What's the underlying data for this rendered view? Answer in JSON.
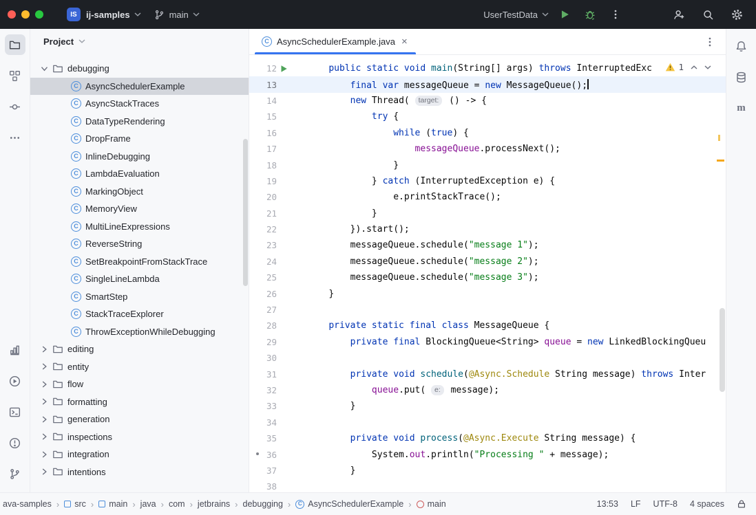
{
  "colors": {
    "accent": "#3574f0",
    "run-green": "#5fad65",
    "warning": "#f5c440",
    "kw": "#0033b3",
    "str": "#067d17",
    "field": "#871094",
    "mth": "#00627a",
    "ann": "#9e880d",
    "caret-row": "#ecf3fd",
    "selection": "#d3d6dc",
    "titlebar": "#1d2025",
    "panel": "#f7f8fa",
    "border": "#ebecf0"
  },
  "titlebar": {
    "project_badge": "IS",
    "project_name": "ij-samples",
    "branch": "main",
    "run_config": "UserTestData"
  },
  "left_strip": {
    "top": [
      "project-folder",
      "structure",
      "commit",
      "more-tools"
    ],
    "bottom": [
      "profiler",
      "services",
      "terminal",
      "problems",
      "version-control"
    ]
  },
  "right_strip": [
    "notifications",
    "database",
    "maven"
  ],
  "project_panel": {
    "title": "Project",
    "tree": [
      {
        "t": "folder",
        "label": "debugging",
        "expanded": true
      },
      {
        "t": "class",
        "label": "AsyncSchedulerExample",
        "selected": true
      },
      {
        "t": "class",
        "label": "AsyncStackTraces"
      },
      {
        "t": "class",
        "label": "DataTypeRendering"
      },
      {
        "t": "class",
        "label": "DropFrame"
      },
      {
        "t": "class",
        "label": "InlineDebugging"
      },
      {
        "t": "class",
        "label": "LambdaEvaluation"
      },
      {
        "t": "class",
        "label": "MarkingObject"
      },
      {
        "t": "class",
        "label": "MemoryView"
      },
      {
        "t": "class",
        "label": "MultiLineExpressions"
      },
      {
        "t": "class",
        "label": "ReverseString"
      },
      {
        "t": "class",
        "label": "SetBreakpointFromStackTrace"
      },
      {
        "t": "class",
        "label": "SingleLineLambda"
      },
      {
        "t": "class",
        "label": "SmartStep"
      },
      {
        "t": "class",
        "label": "StackTraceExplorer"
      },
      {
        "t": "class",
        "label": "ThrowExceptionWhileDebugging"
      },
      {
        "t": "folder",
        "label": "editing"
      },
      {
        "t": "folder",
        "label": "entity"
      },
      {
        "t": "folder",
        "label": "flow"
      },
      {
        "t": "folder",
        "label": "formatting"
      },
      {
        "t": "folder",
        "label": "generation"
      },
      {
        "t": "folder",
        "label": "inspections"
      },
      {
        "t": "folder",
        "label": "integration"
      },
      {
        "t": "folder",
        "label": "intentions"
      }
    ]
  },
  "editor": {
    "tab_label": "AsyncSchedulerExample.java",
    "inspection": {
      "warning_count": "1"
    },
    "lines": [
      {
        "n": "12",
        "run": true,
        "ind": 4,
        "segs": [
          [
            "kw",
            "public static void "
          ],
          [
            "mth",
            "main"
          ],
          [
            "pln",
            "(String[] args) "
          ],
          [
            "kw",
            "throws"
          ],
          [
            "pln",
            " InterruptedExc"
          ]
        ]
      },
      {
        "n": "13",
        "cur": true,
        "caret": true,
        "ind": 8,
        "segs": [
          [
            "kw",
            "final var "
          ],
          [
            "pln",
            "messageQueue = "
          ],
          [
            "kw",
            "new"
          ],
          [
            "pln",
            " MessageQueue();"
          ]
        ]
      },
      {
        "n": "14",
        "ind": 8,
        "segs": [
          [
            "kw",
            "new"
          ],
          [
            "pln",
            " Thread( "
          ],
          [
            "hint",
            "target:"
          ],
          [
            "pln",
            " () -> {"
          ]
        ]
      },
      {
        "n": "15",
        "ind": 12,
        "segs": [
          [
            "kw",
            "try"
          ],
          [
            "pln",
            " {"
          ]
        ]
      },
      {
        "n": "16",
        "ind": 16,
        "segs": [
          [
            "kw",
            "while"
          ],
          [
            "pln",
            " ("
          ],
          [
            "kw",
            "true"
          ],
          [
            "pln",
            ") {"
          ]
        ]
      },
      {
        "n": "17",
        "ind": 20,
        "segs": [
          [
            "field",
            "messageQueue"
          ],
          [
            "pln",
            ".processNext();"
          ]
        ]
      },
      {
        "n": "18",
        "ind": 16,
        "segs": [
          [
            "pln",
            "}"
          ]
        ]
      },
      {
        "n": "19",
        "ind": 12,
        "segs": [
          [
            "pln",
            "} "
          ],
          [
            "kw",
            "catch"
          ],
          [
            "pln",
            " (InterruptedException e) {"
          ]
        ]
      },
      {
        "n": "20",
        "ind": 16,
        "segs": [
          [
            "pln",
            "e.printStackTrace();"
          ]
        ]
      },
      {
        "n": "21",
        "ind": 12,
        "segs": [
          [
            "pln",
            "}"
          ]
        ]
      },
      {
        "n": "22",
        "ind": 8,
        "segs": [
          [
            "pln",
            "}).start();"
          ]
        ]
      },
      {
        "n": "23",
        "ind": 8,
        "segs": [
          [
            "pln",
            "messageQueue.schedule("
          ],
          [
            "str",
            "\"message 1\""
          ],
          [
            "pln",
            ");"
          ]
        ]
      },
      {
        "n": "24",
        "ind": 8,
        "segs": [
          [
            "pln",
            "messageQueue.schedule("
          ],
          [
            "str",
            "\"message 2\""
          ],
          [
            "pln",
            ");"
          ]
        ]
      },
      {
        "n": "25",
        "ind": 8,
        "segs": [
          [
            "pln",
            "messageQueue.schedule("
          ],
          [
            "str",
            "\"message 3\""
          ],
          [
            "pln",
            ");"
          ]
        ]
      },
      {
        "n": "26",
        "ind": 4,
        "segs": [
          [
            "pln",
            "}"
          ]
        ]
      },
      {
        "n": "27",
        "segs": []
      },
      {
        "n": "28",
        "ind": 4,
        "segs": [
          [
            "kw",
            "private static final class "
          ],
          [
            "pln",
            "MessageQueue {"
          ]
        ]
      },
      {
        "n": "29",
        "ind": 8,
        "segs": [
          [
            "kw",
            "private final "
          ],
          [
            "pln",
            "BlockingQueue<String> "
          ],
          [
            "field",
            "queue"
          ],
          [
            "pln",
            " = "
          ],
          [
            "kw",
            "new"
          ],
          [
            "pln",
            " LinkedBlockingQueu"
          ]
        ]
      },
      {
        "n": "30",
        "segs": []
      },
      {
        "n": "31",
        "ind": 8,
        "segs": [
          [
            "kw",
            "private void "
          ],
          [
            "mth",
            "schedule"
          ],
          [
            "pln",
            "("
          ],
          [
            "ann",
            "@Async.Schedule"
          ],
          [
            "pln",
            " String message) "
          ],
          [
            "kw",
            "throws"
          ],
          [
            "pln",
            " Inter"
          ]
        ]
      },
      {
        "n": "32",
        "ind": 12,
        "segs": [
          [
            "field",
            "queue"
          ],
          [
            "pln",
            ".put( "
          ],
          [
            "hint",
            "e:"
          ],
          [
            "pln",
            " message);"
          ]
        ]
      },
      {
        "n": "33",
        "ind": 8,
        "segs": [
          [
            "pln",
            "}"
          ]
        ]
      },
      {
        "n": "34",
        "segs": []
      },
      {
        "n": "35",
        "ind": 8,
        "segs": [
          [
            "kw",
            "private void "
          ],
          [
            "mth",
            "process"
          ],
          [
            "pln",
            "("
          ],
          [
            "ann",
            "@Async.Execute"
          ],
          [
            "pln",
            " String message) {"
          ]
        ]
      },
      {
        "n": "36",
        "ind": 12,
        "segs": [
          [
            "pln",
            "System."
          ],
          [
            "field",
            "out"
          ],
          [
            "pln",
            ".println("
          ],
          [
            "str",
            "\"Processing \""
          ],
          [
            "pln",
            " + message);"
          ]
        ]
      },
      {
        "n": "37",
        "ind": 8,
        "segs": [
          [
            "pln",
            "}"
          ]
        ]
      },
      {
        "n": "38",
        "segs": []
      }
    ]
  },
  "statusbar": {
    "breadcrumbs": [
      {
        "icon": "",
        "label": "ava-samples"
      },
      {
        "icon": "src",
        "label": "src"
      },
      {
        "icon": "src",
        "label": "main"
      },
      {
        "icon": "",
        "label": "java"
      },
      {
        "icon": "",
        "label": "com"
      },
      {
        "icon": "",
        "label": "jetbrains"
      },
      {
        "icon": "",
        "label": "debugging"
      },
      {
        "icon": "class",
        "label": "AsyncSchedulerExample"
      },
      {
        "icon": "method",
        "label": "main"
      }
    ],
    "caret_position": "13:53",
    "line_separator": "LF",
    "encoding": "UTF-8",
    "indent": "4 spaces"
  }
}
